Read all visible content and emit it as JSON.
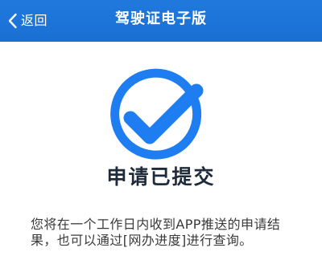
{
  "header": {
    "back_label": "返回",
    "title": "驾驶证电子版"
  },
  "result": {
    "icon": "check-circle-icon",
    "title": "申请已提交",
    "message": "您将在一个工作日内收到APP推送的申请结果，也可以通过[网办进度]进行查询。"
  },
  "colors": {
    "nav_background": "#1e75dc",
    "accent_blue": "#1e7df0",
    "title_text": "#1f2b3a",
    "body_text": "#3a3a3a"
  }
}
